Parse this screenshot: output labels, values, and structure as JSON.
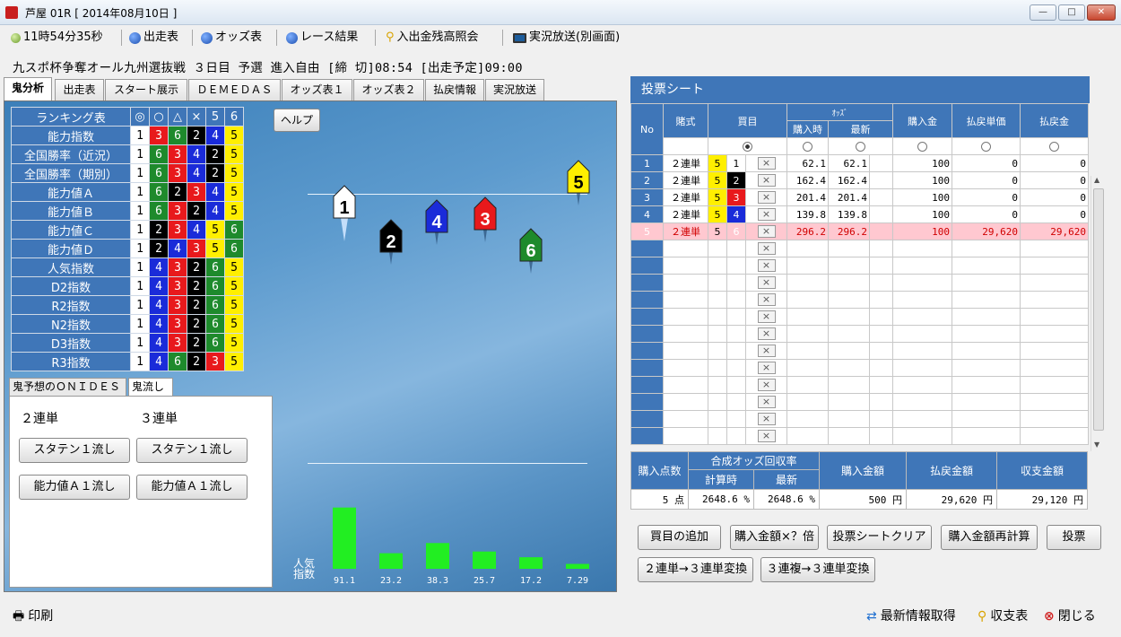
{
  "window": {
    "title": "芦屋 01R [ 2014年08月10日 ]",
    "buttons": {
      "minimize": "—",
      "maximize": "□",
      "close": "✕"
    }
  },
  "toolbar": {
    "clock": "11時54分35秒",
    "entries": "出走表",
    "odds": "オッズ表",
    "results": "レース結果",
    "balance": "入出金残高照会",
    "live": "実況放送(別画面)"
  },
  "race_title": "九スポ杯争奪オール九州選抜戦 ３日目 予選 進入自由 [締 切]08:54 [出走予定]09:00",
  "tabs": [
    "鬼分析",
    "出走表",
    "スタート展示",
    "ＤＥＭＥＤＡＳ",
    "オッズ表１",
    "オッズ表２",
    "払戻情報",
    "実況放送"
  ],
  "ranking": {
    "header_label": "ランキング表",
    "symbols": [
      "◎",
      "○",
      "△",
      "×",
      "5",
      "6"
    ],
    "rows": [
      {
        "label": "能力指数",
        "lanes": [
          1,
          3,
          6,
          2,
          4,
          5
        ]
      },
      {
        "label": "全国勝率（近況）",
        "lanes": [
          1,
          6,
          3,
          4,
          2,
          5
        ]
      },
      {
        "label": "全国勝率（期別）",
        "lanes": [
          1,
          6,
          3,
          4,
          2,
          5
        ]
      },
      {
        "label": "能力値Ａ",
        "lanes": [
          1,
          6,
          2,
          3,
          4,
          5
        ]
      },
      {
        "label": "能力値Ｂ",
        "lanes": [
          1,
          6,
          3,
          2,
          4,
          5
        ]
      },
      {
        "label": "能力値Ｃ",
        "lanes": [
          1,
          2,
          3,
          4,
          5,
          6
        ]
      },
      {
        "label": "能力値Ｄ",
        "lanes": [
          1,
          2,
          4,
          3,
          5,
          6
        ]
      },
      {
        "label": "人気指数",
        "lanes": [
          1,
          4,
          3,
          2,
          6,
          5
        ]
      },
      {
        "label": "D2指数",
        "lanes": [
          1,
          4,
          3,
          2,
          6,
          5
        ]
      },
      {
        "label": "R2指数",
        "lanes": [
          1,
          4,
          3,
          2,
          6,
          5
        ]
      },
      {
        "label": "N2指数",
        "lanes": [
          1,
          4,
          3,
          2,
          6,
          5
        ]
      },
      {
        "label": "D3指数",
        "lanes": [
          1,
          4,
          3,
          2,
          6,
          5
        ]
      },
      {
        "label": "R3指数",
        "lanes": [
          1,
          4,
          6,
          2,
          3,
          5
        ]
      }
    ]
  },
  "help_label": "ヘルプ",
  "subtabs": [
    "鬼予想のＯＮＩＤＥＳ",
    "鬼流し"
  ],
  "nagashi": {
    "col2_label": "２連単",
    "col3_label": "３連単",
    "btn_2_staten": "スタテン１流し",
    "btn_3_staten": "スタテン１流し",
    "btn_2_nouryoku": "能力値Ａ１流し",
    "btn_3_nouryoku": "能力値Ａ１流し"
  },
  "boats": [
    {
      "num": "1",
      "color": "#ffffff",
      "text": "#000000"
    },
    {
      "num": "2",
      "color": "#000000",
      "text": "#ffffff"
    },
    {
      "num": "3",
      "color": "#e8191c",
      "text": "#ffffff"
    },
    {
      "num": "4",
      "color": "#1a2bd9",
      "text": "#ffffff"
    },
    {
      "num": "5",
      "color": "#ffef00",
      "text": "#000000"
    },
    {
      "num": "6",
      "color": "#1e8a2c",
      "text": "#ffffff"
    }
  ],
  "chart_data": {
    "type": "bar",
    "title": "",
    "ylabel": "人気指数",
    "categories": [
      "1",
      "2",
      "3",
      "4",
      "5",
      "6"
    ],
    "values": [
      91.1,
      23.2,
      38.3,
      25.7,
      17.2,
      7.29
    ],
    "value_labels": [
      "91.1",
      "23.2",
      "38.3",
      "25.7",
      "17.2",
      "7.29"
    ],
    "ylim": [
      0,
      100
    ],
    "color": "#22ee22",
    "label_line1": "人気",
    "label_line2": "指数"
  },
  "sheet": {
    "title": "投票シート",
    "headers": {
      "no": "No",
      "bet_type": "賭式",
      "combo": "買目",
      "odds_group": "ｵｯｽﾞ",
      "odds_at_buy": "購入時",
      "odds_latest": "最新",
      "amount": "購入金",
      "payout_unit": "払戻単価",
      "payout": "払戻金"
    },
    "rows": [
      {
        "no": "1",
        "type": "２連単",
        "first": "5",
        "second": "1",
        "odds_buy": "62.1",
        "odds_now": "62.1",
        "amount": "100",
        "unit": "0",
        "payout": "0",
        "hl": false
      },
      {
        "no": "2",
        "type": "２連単",
        "first": "5",
        "second": "2",
        "odds_buy": "162.4",
        "odds_now": "162.4",
        "amount": "100",
        "unit": "0",
        "payout": "0",
        "hl": false
      },
      {
        "no": "3",
        "type": "２連単",
        "first": "5",
        "second": "3",
        "odds_buy": "201.4",
        "odds_now": "201.4",
        "amount": "100",
        "unit": "0",
        "payout": "0",
        "hl": false
      },
      {
        "no": "4",
        "type": "２連単",
        "first": "5",
        "second": "4",
        "odds_buy": "139.8",
        "odds_now": "139.8",
        "amount": "100",
        "unit": "0",
        "payout": "0",
        "hl": false
      },
      {
        "no": "5",
        "type": "２連単",
        "first": "5",
        "second": "6",
        "odds_buy": "296.2",
        "odds_now": "296.2",
        "amount": "100",
        "unit": "29,620",
        "payout": "29,620",
        "hl": true
      }
    ],
    "empty_rows": 12,
    "x_label": "×"
  },
  "summary": {
    "points_label": "購入点数",
    "synth_label": "合成オッズ回収率",
    "at_buy_label": "計算時",
    "latest_label": "最新",
    "amount_label": "購入金額",
    "payout_label": "払戻金額",
    "net_label": "収支金額",
    "points": "5 点",
    "synth_buy": "2648.6 %",
    "synth_now": "2648.6 %",
    "amount": "500 円",
    "payout": "29,620 円",
    "net": "29,120 円"
  },
  "actions": {
    "add": "買目の追加",
    "multiply": "購入金額×？倍",
    "clear": "投票シートクリア",
    "recalc": "購入金額再計算",
    "vote": "投票",
    "conv_2to3": "２連単→３連単変換",
    "conv_3f": "３連複→３連単変換"
  },
  "statusbar": {
    "print": "印刷",
    "refresh": "最新情報取得",
    "ledger": "収支表",
    "close": "閉じる"
  }
}
